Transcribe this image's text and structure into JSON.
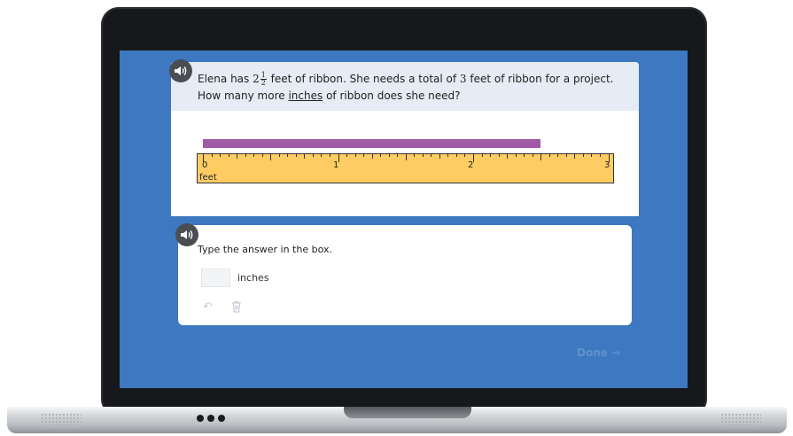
{
  "question": {
    "text_part1": "Elena has ",
    "mixed_whole": "2",
    "mixed_num": "1",
    "mixed_den": "2",
    "text_part2": " feet of ribbon. She needs a total of ",
    "total_feet": "3",
    "text_part3": " feet of ribbon for a project.",
    "text_line2_a": "How many more ",
    "text_line2_underlined": "inches",
    "text_line2_b": " of ribbon does she need?"
  },
  "ruler": {
    "labels": [
      "0",
      "1",
      "2",
      "3"
    ],
    "unit": "feet",
    "max": 3,
    "ribbon_length_feet": 2.5
  },
  "answer": {
    "prompt": "Type the answer in the box.",
    "unit_label": "inches",
    "value": ""
  },
  "buttons": {
    "done_label": "Done →",
    "undo_icon": "↶"
  },
  "colors": {
    "screen_bg": "#3d78c0",
    "ribbon": "#a05aa6",
    "ruler": "#fecc63"
  }
}
